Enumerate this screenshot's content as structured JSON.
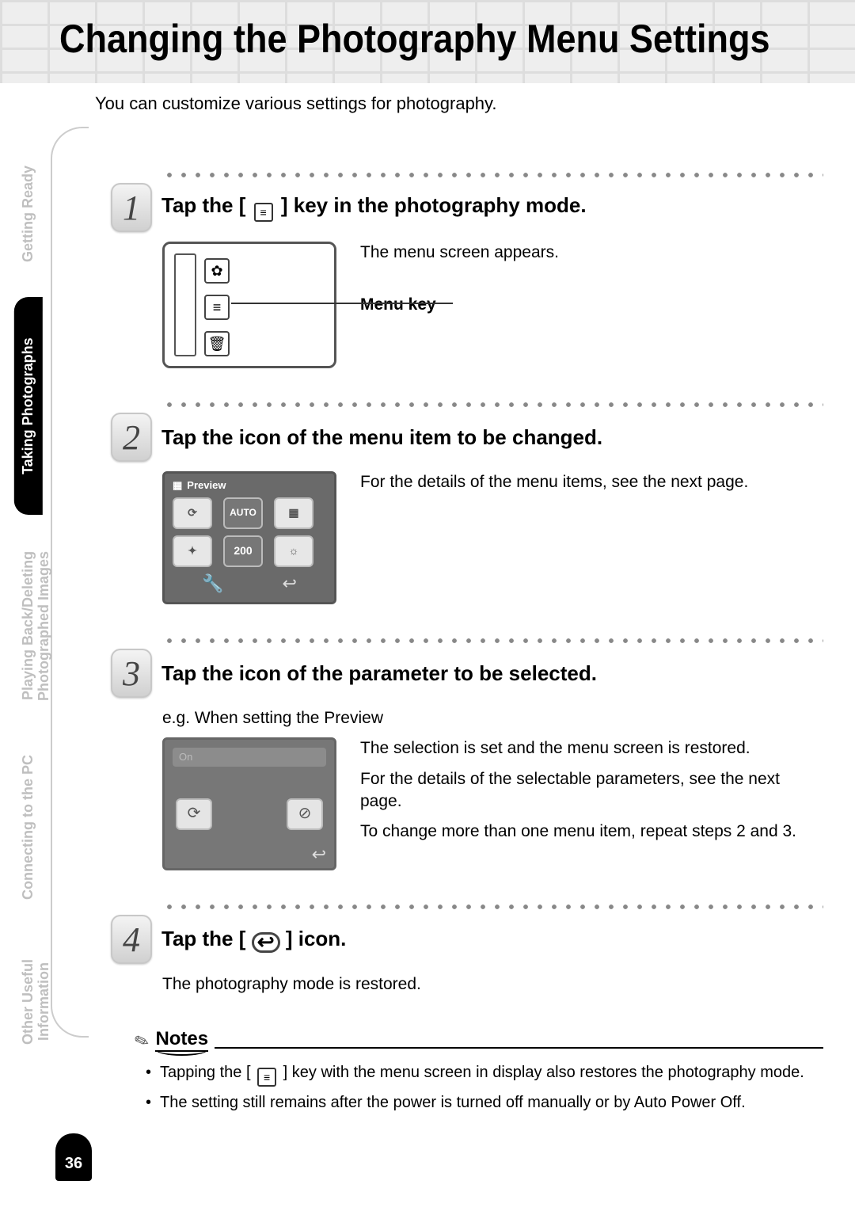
{
  "page_number": "36",
  "title": "Changing the Photography Menu Settings",
  "intro": "You can customize various settings for photography.",
  "sidebar": {
    "tabs": [
      {
        "label": "Getting Ready"
      },
      {
        "label": "Taking Photographs"
      },
      {
        "label": "Playing Back/Deleting Photographed Images"
      },
      {
        "label": "Connecting to the PC"
      },
      {
        "label": "Other Useful Information"
      }
    ],
    "active_index": 1
  },
  "steps": [
    {
      "num": "1",
      "title_before": "Tap the [ ",
      "title_icon": "menu-icon",
      "title_after": " ] key in the photography mode.",
      "desc1": "The menu screen appears.",
      "menu_key_label": "Menu key"
    },
    {
      "num": "2",
      "title": "Tap the icon of the menu item to be changed.",
      "screen_header": "Preview",
      "auto_label": "AUTO",
      "iso_label": "200",
      "desc1": "For the details of the menu items, see the next page."
    },
    {
      "num": "3",
      "title": "Tap the icon of the parameter to be selected.",
      "sub": "e.g. When setting the Preview",
      "param_label": "On",
      "desc1": "The selection is set and the menu screen is restored.",
      "desc2": "For the details of the selectable parameters, see the next page.",
      "desc3": "To change more than one menu item, repeat steps 2 and 3."
    },
    {
      "num": "4",
      "title_before": "Tap the [ ",
      "title_icon": "back-icon",
      "title_after": " ] icon.",
      "desc1": "The photography mode is restored."
    }
  ],
  "notes": {
    "heading": "Notes",
    "items": [
      {
        "before": "Tapping the [ ",
        "after": " ] key with the menu screen in display also restores the photography mode."
      },
      {
        "text": "The setting still remains after the power is turned off manually or by Auto Power Off."
      }
    ]
  }
}
